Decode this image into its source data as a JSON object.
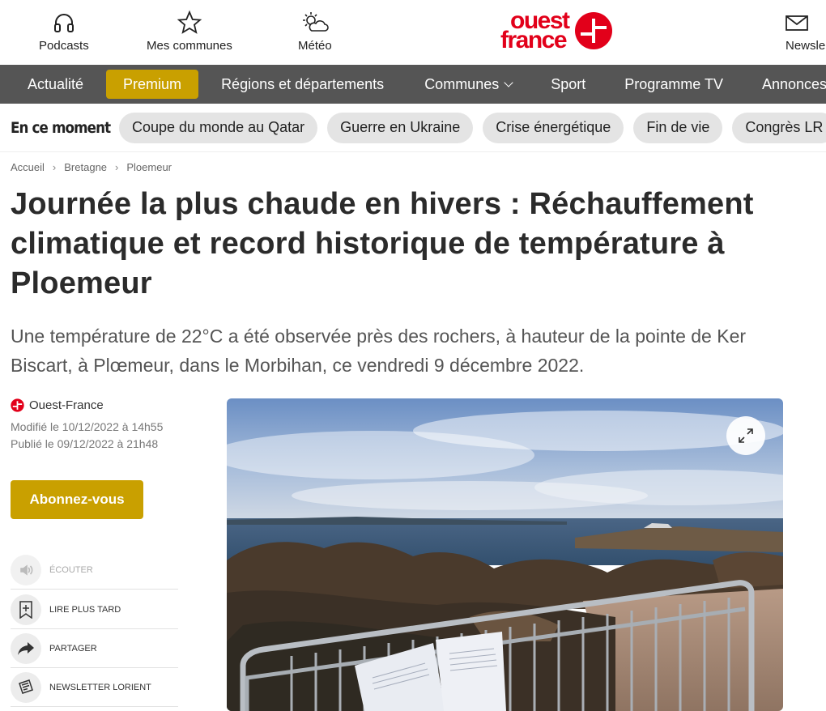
{
  "header": {
    "items": [
      {
        "label": "Podcasts",
        "icon": "headphones-icon"
      },
      {
        "label": "Mes communes",
        "icon": "star-icon"
      },
      {
        "label": "Météo",
        "icon": "weather-icon"
      },
      {
        "label": "Newsle",
        "icon": "mail-icon"
      }
    ],
    "logo": {
      "line1": "ouest",
      "line2": "france",
      "color": "#e2001a"
    }
  },
  "nav": {
    "items": [
      "Actualité",
      "Premium",
      "Régions et départements",
      "Communes",
      "Sport",
      "Programme TV",
      "Annonces"
    ],
    "background": "#555555",
    "premium_color": "#c9a000"
  },
  "moment": {
    "title": "En ce moment",
    "chips": [
      "Coupe du monde au Qatar",
      "Guerre en Ukraine",
      "Crise énergétique",
      "Fin de vie",
      "Congrès LR"
    ]
  },
  "breadcrumb": [
    "Accueil",
    "Bretagne",
    "Ploemeur"
  ],
  "article": {
    "title": "Journée la plus chaude en hivers : Réchauffement climatique et record historique de température à Ploemeur",
    "lede": "Une température de 22°C a été observée près des rochers, à hauteur de la pointe de Ker Biscart, à Plœmeur, dans le Morbihan, ce vendredi 9 décembre 2022.",
    "source": "Ouest-France",
    "modified": "Modifié le 10/12/2022 à 14h55",
    "published": "Publié le 09/12/2022 à 21h48"
  },
  "sidebar": {
    "subscribe_label": "Abonnez-vous",
    "actions": [
      {
        "label": "ÉCOUTER",
        "icon": "speaker-icon"
      },
      {
        "label": "LIRE PLUS TARD",
        "icon": "bookmark-add-icon"
      },
      {
        "label": "PARTAGER",
        "icon": "share-arrow-icon"
      },
      {
        "label": "NEWSLETTER LORIENT",
        "icon": "newsletter-icon"
      }
    ]
  }
}
